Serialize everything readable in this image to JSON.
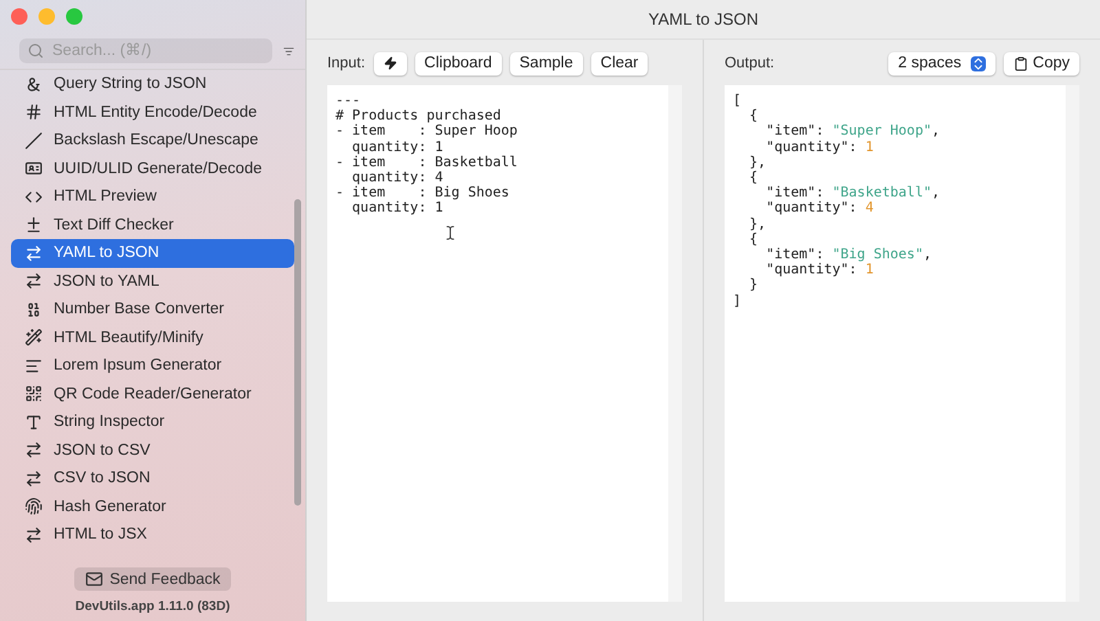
{
  "window": {
    "title": "YAML to JSON"
  },
  "sidebar": {
    "search": {
      "placeholder": "Search... (⌘/)"
    },
    "items": [
      {
        "label": "Query String to JSON",
        "selected": false
      },
      {
        "label": "HTML Entity Encode/Decode",
        "selected": false
      },
      {
        "label": "Backslash Escape/Unescape",
        "selected": false
      },
      {
        "label": "UUID/ULID Generate/Decode",
        "selected": false
      },
      {
        "label": "HTML Preview",
        "selected": false
      },
      {
        "label": "Text Diff Checker",
        "selected": false
      },
      {
        "label": "YAML to JSON",
        "selected": true
      },
      {
        "label": "JSON to YAML",
        "selected": false
      },
      {
        "label": "Number Base Converter",
        "selected": false
      },
      {
        "label": "HTML Beautify/Minify",
        "selected": false
      },
      {
        "label": "Lorem Ipsum Generator",
        "selected": false
      },
      {
        "label": "QR Code Reader/Generator",
        "selected": false
      },
      {
        "label": "String Inspector",
        "selected": false
      },
      {
        "label": "JSON to CSV",
        "selected": false
      },
      {
        "label": "CSV to JSON",
        "selected": false
      },
      {
        "label": "Hash Generator",
        "selected": false
      },
      {
        "label": "HTML to JSX",
        "selected": false
      }
    ],
    "feedback": "Send Feedback",
    "version": "DevUtils.app 1.11.0 (83D)"
  },
  "input": {
    "label": "Input:",
    "buttons": [
      "Clipboard",
      "Sample",
      "Clear"
    ],
    "lines": [
      "---",
      "# Products purchased",
      "- item    : Super Hoop",
      "  quantity: 1",
      "- item    : Basketball",
      "  quantity: 4",
      "- item    : Big Shoes",
      "  quantity: 1"
    ]
  },
  "output": {
    "label": "Output:",
    "indent": "2 spaces",
    "copy": "Copy",
    "lines": [
      [
        {
          "t": "[",
          "kind": "punct"
        }
      ],
      [
        {
          "t": "  {",
          "kind": "punct"
        }
      ],
      [
        {
          "t": "    \"item\": ",
          "kind": "punct"
        },
        {
          "t": "\"Super Hoop\"",
          "kind": "string"
        },
        {
          "t": ",",
          "kind": "punct"
        }
      ],
      [
        {
          "t": "    \"quantity\": ",
          "kind": "punct"
        },
        {
          "t": "1",
          "kind": "number"
        }
      ],
      [
        {
          "t": "  },",
          "kind": "punct"
        }
      ],
      [
        {
          "t": "  {",
          "kind": "punct"
        }
      ],
      [
        {
          "t": "    \"item\": ",
          "kind": "punct"
        },
        {
          "t": "\"Basketball\"",
          "kind": "string"
        },
        {
          "t": ",",
          "kind": "punct"
        }
      ],
      [
        {
          "t": "    \"quantity\": ",
          "kind": "punct"
        },
        {
          "t": "4",
          "kind": "number"
        }
      ],
      [
        {
          "t": "  },",
          "kind": "punct"
        }
      ],
      [
        {
          "t": "  {",
          "kind": "punct"
        }
      ],
      [
        {
          "t": "    \"item\": ",
          "kind": "punct"
        },
        {
          "t": "\"Big Shoes\"",
          "kind": "string"
        },
        {
          "t": ",",
          "kind": "punct"
        }
      ],
      [
        {
          "t": "    \"quantity\": ",
          "kind": "punct"
        },
        {
          "t": "1",
          "kind": "number"
        }
      ],
      [
        {
          "t": "  }",
          "kind": "punct"
        }
      ],
      [
        {
          "t": "]",
          "kind": "punct"
        }
      ]
    ]
  }
}
